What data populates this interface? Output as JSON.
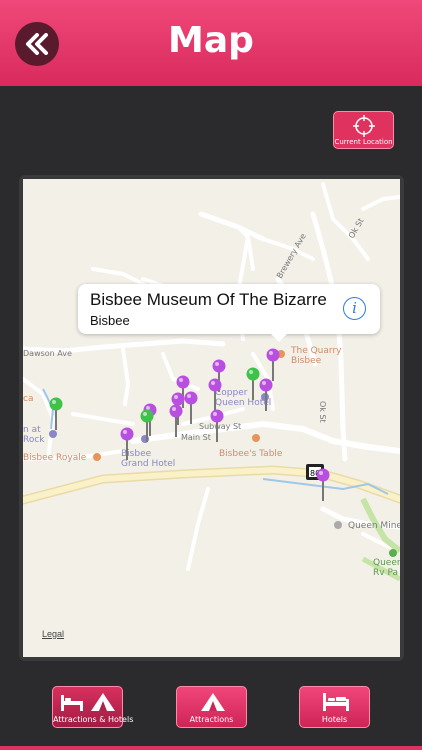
{
  "header": {
    "title": "Map",
    "back_icon": "chevrons-left-icon"
  },
  "location_button": {
    "label": "Current Location",
    "icon": "crosshair-icon"
  },
  "callout": {
    "title": "Bisbee Museum Of The Bizarre",
    "subtitle": "Bisbee",
    "icon": "info-icon"
  },
  "map": {
    "labels": {
      "quarry": "The Quarry\nBisbee",
      "copper": "Copper\nQueen Hotel",
      "subway": "Subway St",
      "main": "Main St",
      "grand": "Bisbee\nGrand Hotel",
      "royale": "Bisbee Royale",
      "table": "Bisbee's Table",
      "okst_top": "Ok St",
      "okst_mid": "Ok St",
      "brewery": "Brewery Ave",
      "dawson": "Dawson Ave",
      "inn": "n at\nRock",
      "queen_mine": "Queen Mine",
      "queen_rv": "Queen\nRv Pa",
      "route": "80",
      "ca": "ca"
    },
    "legal": "Legal",
    "colors": {
      "attraction_pin": "#b84fe0",
      "hotel_pin": "#3ec24a",
      "accent": "#e0325f"
    }
  },
  "tabs": [
    {
      "label": "Attractions & Hotels",
      "icon": "bed-and-tent-icon"
    },
    {
      "label": "Attractions",
      "icon": "tent-icon"
    },
    {
      "label": "Hotels",
      "icon": "bed-icon"
    }
  ]
}
